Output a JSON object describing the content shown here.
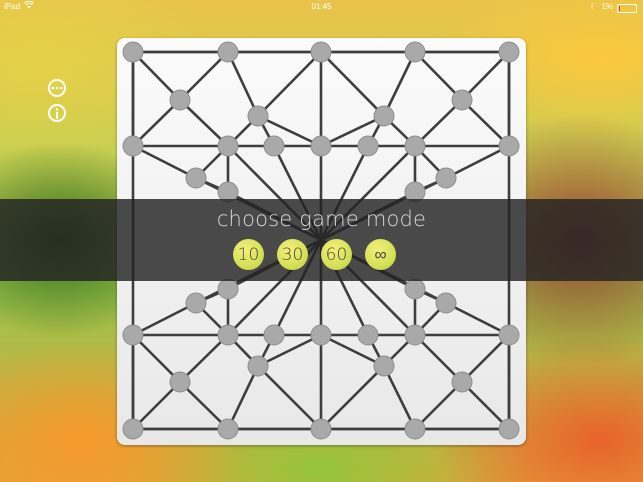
{
  "status_bar": {
    "device": "iPad",
    "time": "01:45",
    "battery_percent": "1%",
    "battery_level": 0.05
  },
  "side_icons": {
    "more": "more-icon",
    "info": "info-icon"
  },
  "game_mode": {
    "title": "choose game mode",
    "options": [
      "10",
      "30",
      "60",
      "∞"
    ]
  },
  "colors": {
    "overlay": "#232323",
    "mode_button": "#d8e15a",
    "node": "#a9a9a9",
    "edge": "#3e3e3e"
  }
}
